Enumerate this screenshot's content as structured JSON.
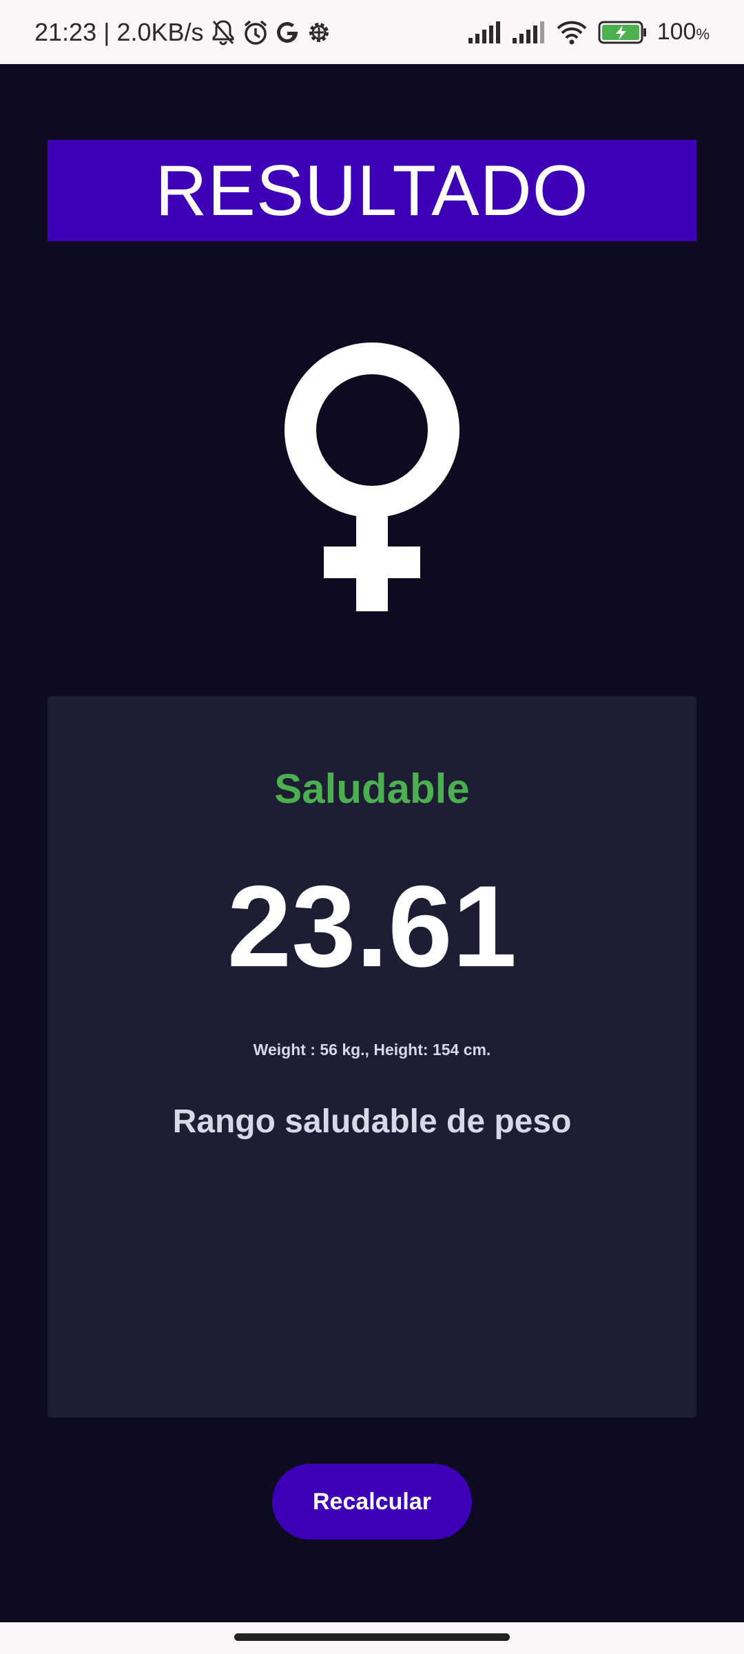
{
  "status_bar": {
    "time": "21:23",
    "separator": "|",
    "net_speed": "2.0KB/s",
    "icons": [
      "bell-off-icon",
      "alarm-icon",
      "google-icon",
      "settings-gear-icon"
    ],
    "right_icons": [
      "signal-icon",
      "signal-icon",
      "wifi-icon",
      "battery-charging-icon"
    ],
    "battery_percent": "100",
    "battery_percent_unit": "%",
    "battery_color": "#4caf50"
  },
  "header": {
    "title": "RESULTADO",
    "banner_color": "#3d00b7"
  },
  "gender": {
    "icon": "female-symbol-icon"
  },
  "result": {
    "status": "Saludable",
    "status_color": "#4caf50",
    "bmi": "23.61",
    "measurements": "Weight : 56 kg., Height: 154 cm.",
    "range_text": "Rango saludable de peso"
  },
  "actions": {
    "recalculate_label": "Recalcular"
  }
}
